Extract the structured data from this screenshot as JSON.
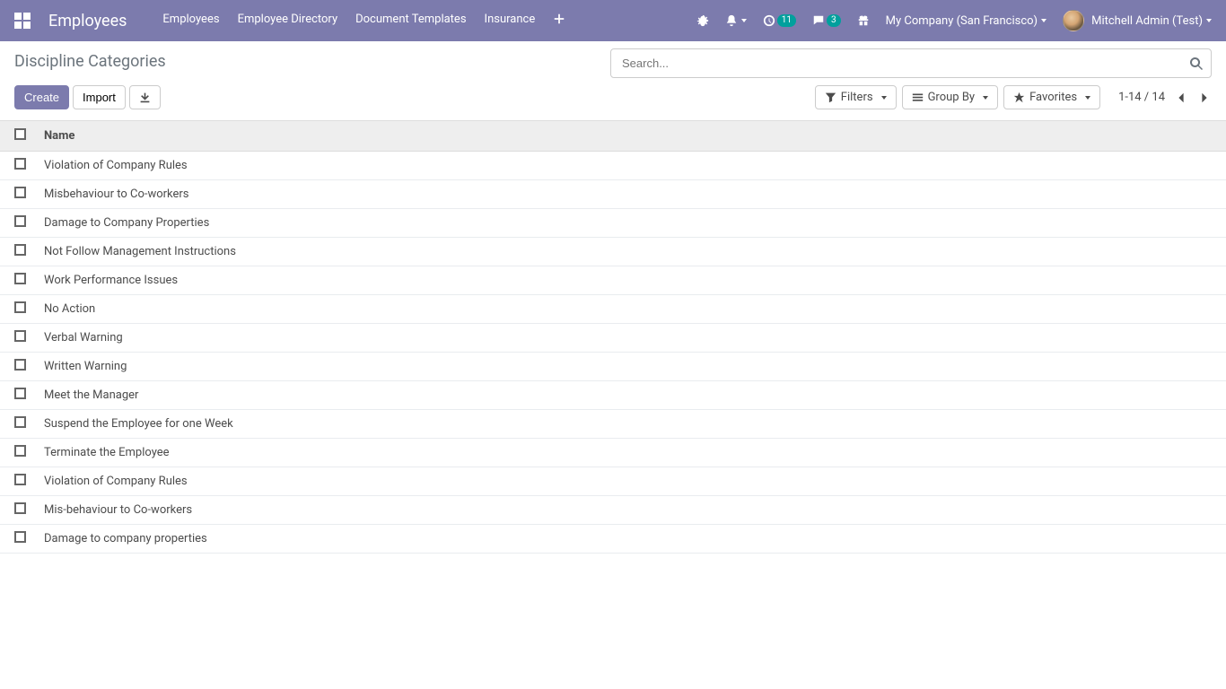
{
  "navbar": {
    "app_name": "Employees",
    "menu": [
      "Employees",
      "Employee Directory",
      "Document Templates",
      "Insurance"
    ],
    "right": {
      "clock_badge": "11",
      "chat_badge": "3",
      "company": "My Company (San Francisco)",
      "user": "Mitchell Admin (Test)"
    }
  },
  "control_panel": {
    "title": "Discipline Categories",
    "search": {
      "placeholder": "Search..."
    },
    "buttons": {
      "create": "Create",
      "import": "Import"
    },
    "filters_label": "Filters",
    "groupby_label": "Group By",
    "favorites_label": "Favorites",
    "pager": "1-14 / 14"
  },
  "table": {
    "header": {
      "name": "Name"
    },
    "rows": [
      {
        "name": "Violation of Company Rules"
      },
      {
        "name": "Misbehaviour to Co-workers"
      },
      {
        "name": "Damage to Company Properties"
      },
      {
        "name": "Not Follow Management Instructions"
      },
      {
        "name": "Work Performance Issues"
      },
      {
        "name": "No Action"
      },
      {
        "name": "Verbal Warning"
      },
      {
        "name": "Written Warning"
      },
      {
        "name": "Meet the Manager"
      },
      {
        "name": "Suspend the Employee for one Week"
      },
      {
        "name": "Terminate the Employee"
      },
      {
        "name": "Violation of Company Rules"
      },
      {
        "name": "Mis-behaviour to Co-workers"
      },
      {
        "name": "Damage to company properties"
      }
    ]
  }
}
